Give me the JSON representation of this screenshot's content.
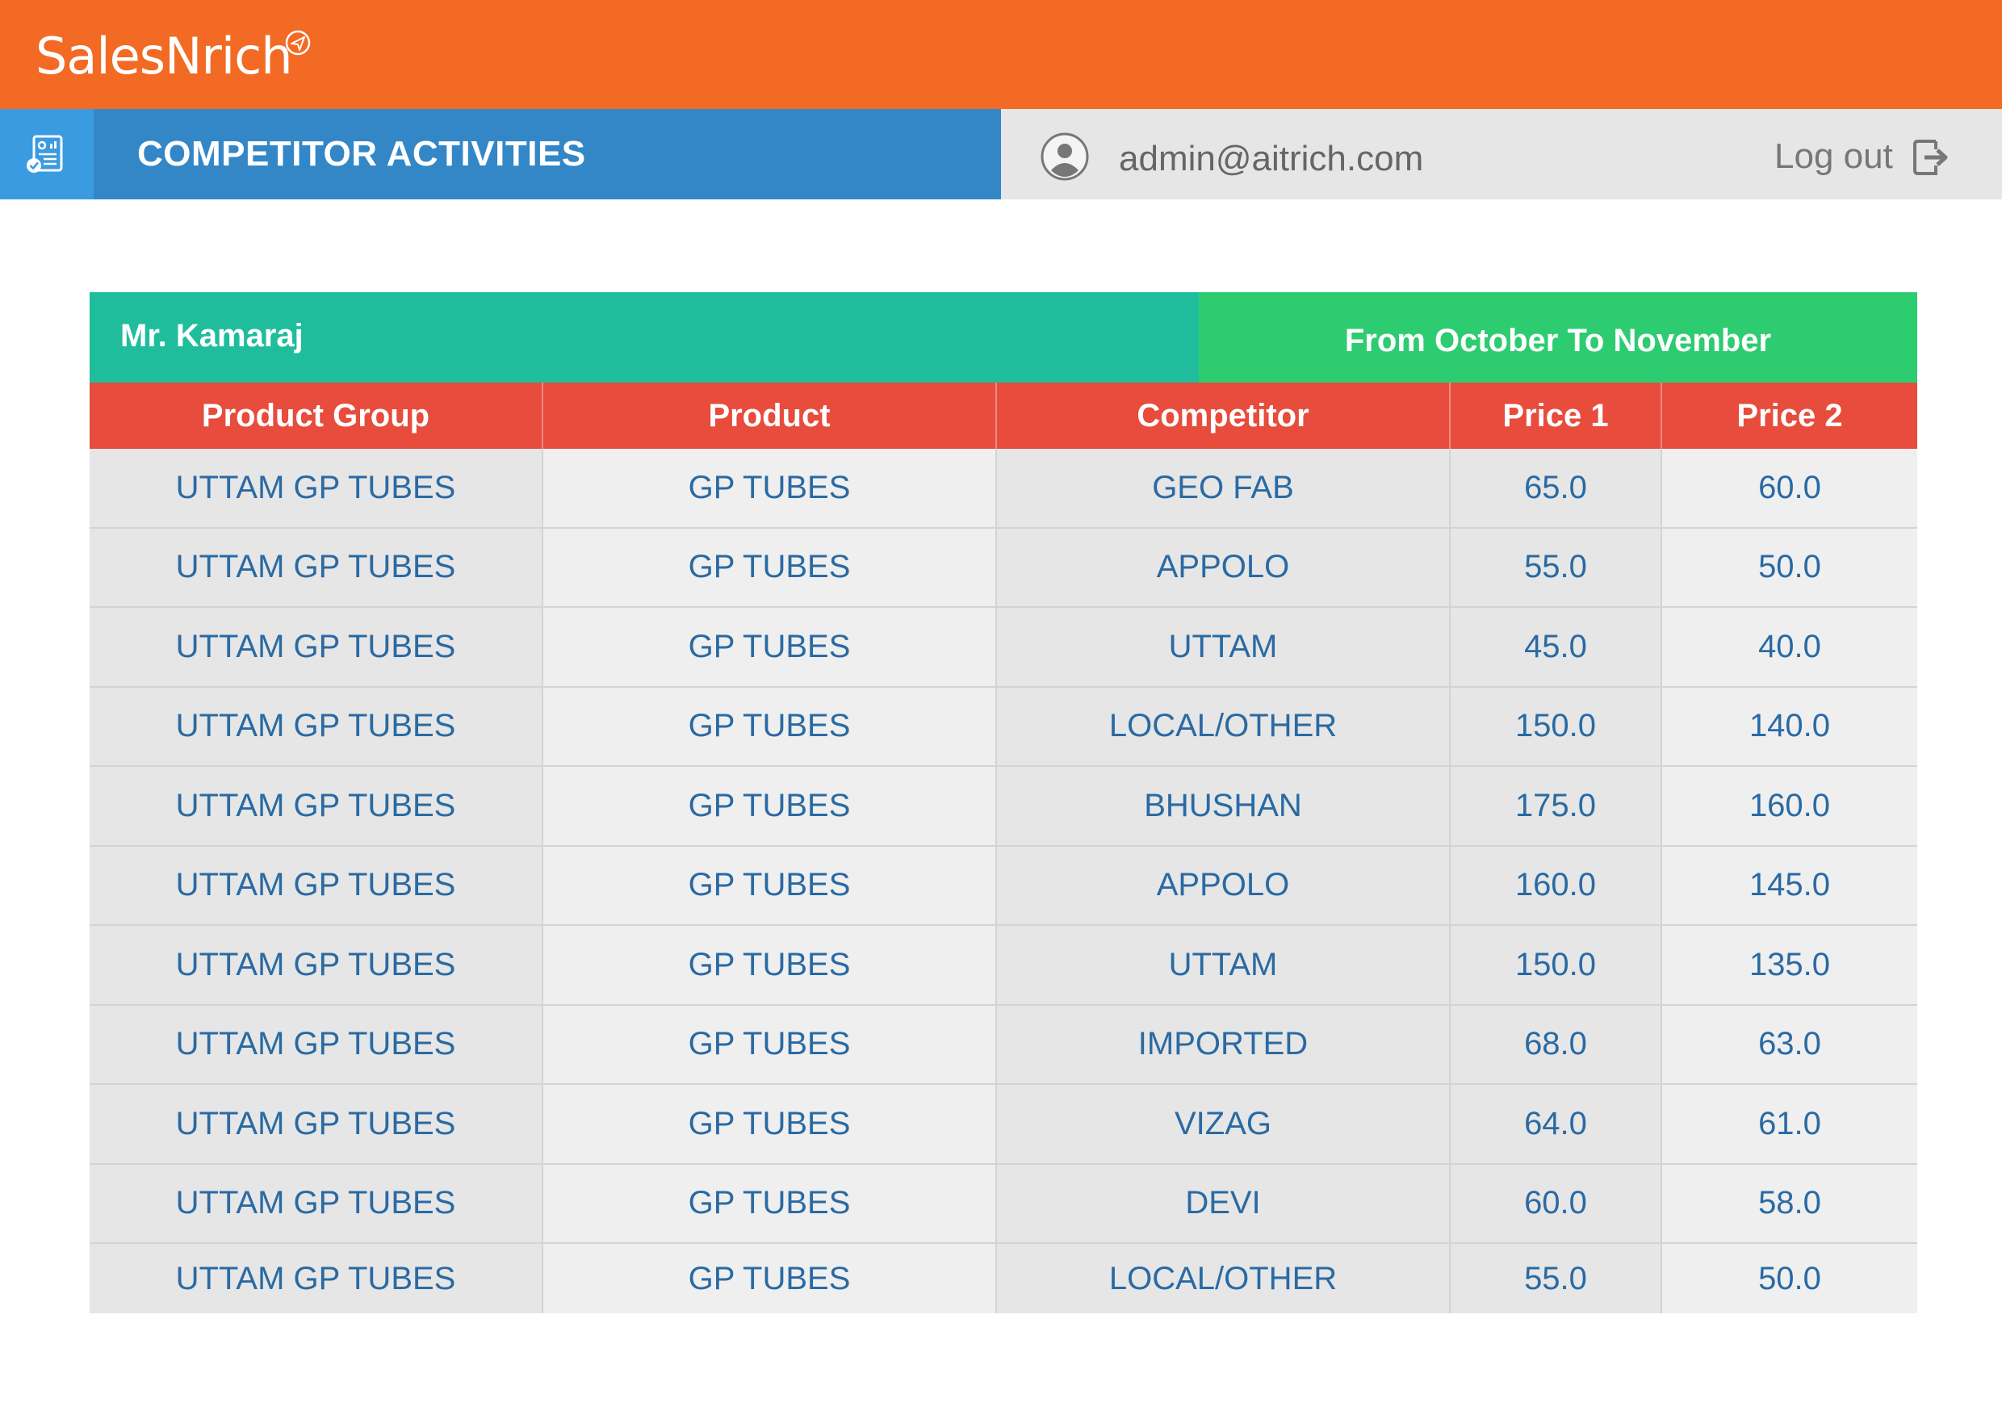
{
  "app": {
    "brand": "SalesNrich"
  },
  "header": {
    "title": "COMPETITOR ACTIVITIES",
    "user_email": "admin@aitrich.com",
    "logout_label": "Log out"
  },
  "report": {
    "person": "Mr. Kamaraj",
    "period": "From October To November",
    "columns": [
      "Product Group",
      "Product",
      "Competitor",
      "Price 1",
      "Price 2"
    ],
    "rows": [
      [
        "UTTAM GP TUBES",
        "GP TUBES",
        "GEO FAB",
        "65.0",
        "60.0"
      ],
      [
        "UTTAM GP TUBES",
        "GP TUBES",
        "APPOLO",
        "55.0",
        "50.0"
      ],
      [
        "UTTAM GP TUBES",
        "GP TUBES",
        "UTTAM",
        "45.0",
        "40.0"
      ],
      [
        "UTTAM GP TUBES",
        "GP TUBES",
        "LOCAL/OTHER",
        "150.0",
        "140.0"
      ],
      [
        "UTTAM GP TUBES",
        "GP TUBES",
        "BHUSHAN",
        "175.0",
        "160.0"
      ],
      [
        "UTTAM GP TUBES",
        "GP TUBES",
        "APPOLO",
        "160.0",
        "145.0"
      ],
      [
        "UTTAM GP TUBES",
        "GP TUBES",
        "UTTAM",
        "150.0",
        "135.0"
      ],
      [
        "UTTAM GP TUBES",
        "GP TUBES",
        "IMPORTED",
        "68.0",
        "63.0"
      ],
      [
        "UTTAM GP TUBES",
        "GP TUBES",
        "VIZAG",
        "64.0",
        "61.0"
      ],
      [
        "UTTAM GP TUBES",
        "GP TUBES",
        "DEVI",
        "60.0",
        "58.0"
      ],
      [
        "UTTAM GP TUBES",
        "GP TUBES",
        "LOCAL/OTHER",
        "55.0",
        "50.0"
      ]
    ]
  },
  "colors": {
    "topbar": "#f26a23",
    "titlebar": "#3387c7",
    "name_band": "#1fbd9c",
    "period_band": "#2ecc71",
    "table_header": "#e74c3c",
    "cell_text": "#2a6aa3"
  },
  "icons": {
    "brand_mark": "paper-plane-icon",
    "title": "report-document-icon",
    "user": "user-avatar-icon",
    "logout": "logout-icon"
  }
}
